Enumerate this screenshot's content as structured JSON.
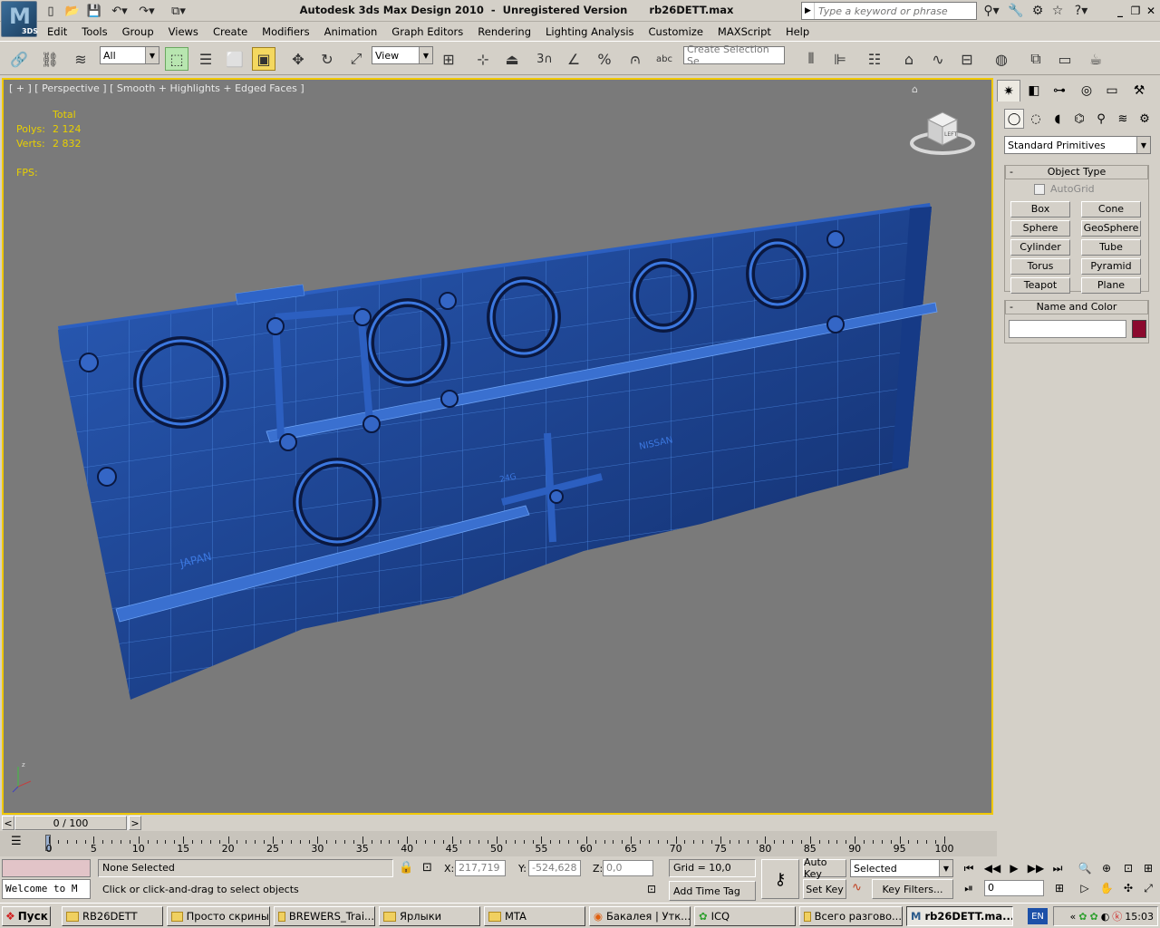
{
  "app": {
    "title": "Autodesk 3ds Max Design 2010  -  Unregistered Version      rb26DETT.max",
    "logo_letter": "M",
    "logo_sub": "3DS"
  },
  "search": {
    "placeholder": "Type a keyword or phrase"
  },
  "menus": [
    "Edit",
    "Tools",
    "Group",
    "Views",
    "Create",
    "Modifiers",
    "Animation",
    "Graph Editors",
    "Rendering",
    "Lighting Analysis",
    "Customize",
    "MAXScript",
    "Help"
  ],
  "toolbar": {
    "selection_filter": "All",
    "ref_coord": "View",
    "named_selection_placeholder": "Create Selection Se",
    "snap_label": "3"
  },
  "viewport": {
    "label": "[ + ] [ Perspective ] [ Smooth + Highlights + Edged Faces ]",
    "stats": {
      "header": "Total",
      "polys_label": "Polys:",
      "polys_value": "2 124",
      "verts_label": "Verts:",
      "verts_value": "2 832",
      "fps_label": "FPS:"
    },
    "viewcube_face": "LEFT",
    "engraving_1": "JAPAN",
    "engraving_2": "NISSAN",
    "engraving_3": "24G"
  },
  "command_panel": {
    "category": "Standard Primitives",
    "object_type": {
      "title": "Object Type",
      "autogrid": "AutoGrid",
      "buttons": [
        "Box",
        "Cone",
        "Sphere",
        "GeoSphere",
        "Cylinder",
        "Tube",
        "Torus",
        "Pyramid",
        "Teapot",
        "Plane"
      ]
    },
    "name_color": {
      "title": "Name and Color",
      "color": "#8b0a2e"
    }
  },
  "timeline": {
    "frame_display": "0 / 100",
    "ticks": [
      "0",
      "5",
      "10",
      "15",
      "20",
      "25",
      "30",
      "35",
      "40",
      "45",
      "50",
      "55",
      "60",
      "65",
      "70",
      "75",
      "80",
      "85",
      "90",
      "95",
      "100"
    ]
  },
  "status": {
    "maxscript_listener": "Welcome to M",
    "selection": "None Selected",
    "prompt": "Click or click-and-drag to select objects",
    "x_label": "X:",
    "x_value": "217,719",
    "y_label": "Y:",
    "y_value": "-524,628",
    "z_label": "Z:",
    "z_value": "0,0",
    "grid": "Grid = 10,0",
    "add_time_tag": "Add Time Tag",
    "auto_key": "Auto Key",
    "set_key": "Set Key",
    "key_mode": "Selected",
    "key_filters": "Key Filters...",
    "current_frame": "0"
  },
  "taskbar": {
    "start": "Пуск",
    "tasks": [
      "RB26DETT",
      "Просто скрины",
      "BREWERS_Trai...",
      "Ярлыки",
      "MTA",
      "Бакалея | Утк...",
      "ICQ",
      "Всего разгово...",
      "rb26DETT.ma..."
    ],
    "lang": "EN",
    "time": "15:03"
  },
  "colors": {
    "viewport_bg": "#7a7a7a",
    "model_blue": "#1e4fa8",
    "active_border": "#f0c800",
    "stats_text": "#e8d000"
  }
}
